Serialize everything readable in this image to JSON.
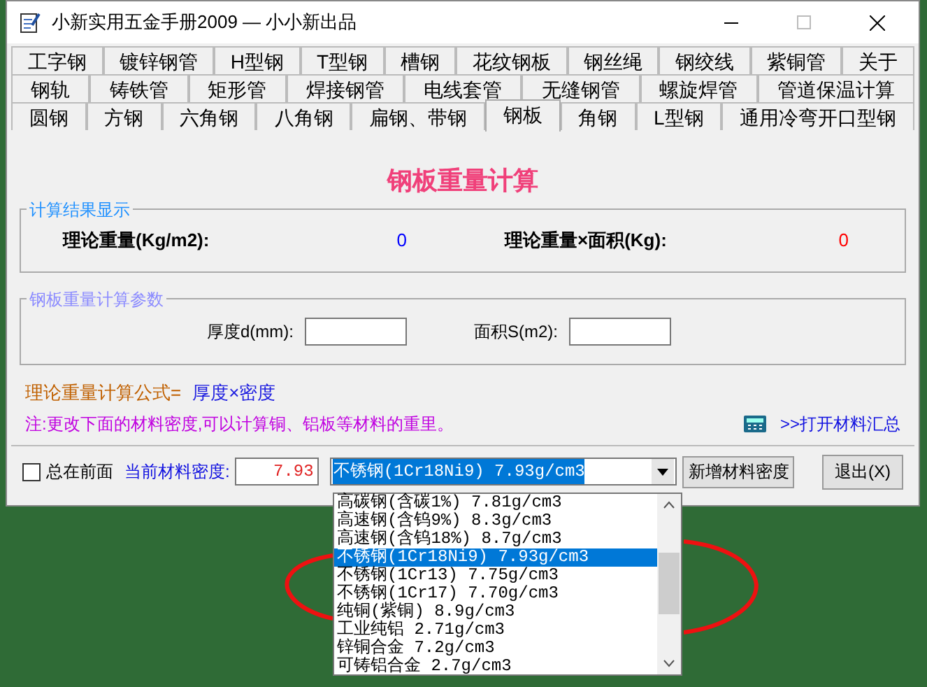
{
  "window": {
    "title": "小新实用五金手册2009 — 小小新出品"
  },
  "tab_rows": [
    [
      {
        "label": "工字钢",
        "selected": false
      },
      {
        "label": "镀锌钢管",
        "selected": false
      },
      {
        "label": "H型钢",
        "selected": false
      },
      {
        "label": "T型钢",
        "selected": false
      },
      {
        "label": "槽钢",
        "selected": false
      },
      {
        "label": "花纹钢板",
        "selected": false
      },
      {
        "label": "钢丝绳",
        "selected": false
      },
      {
        "label": "钢绞线",
        "selected": false
      },
      {
        "label": "紫铜管",
        "selected": false
      },
      {
        "label": "关于",
        "selected": false
      }
    ],
    [
      {
        "label": "钢轨",
        "selected": false
      },
      {
        "label": "铸铁管",
        "selected": false
      },
      {
        "label": "矩形管",
        "selected": false
      },
      {
        "label": "焊接钢管",
        "selected": false
      },
      {
        "label": "电线套管",
        "selected": false
      },
      {
        "label": "无缝钢管",
        "selected": false
      },
      {
        "label": "螺旋焊管",
        "selected": false
      },
      {
        "label": "管道保温计算",
        "selected": false
      }
    ],
    [
      {
        "label": "圆钢",
        "selected": false
      },
      {
        "label": "方钢",
        "selected": false
      },
      {
        "label": "六角钢",
        "selected": false
      },
      {
        "label": "八角钢",
        "selected": false
      },
      {
        "label": "扁钢、带钢",
        "selected": false
      },
      {
        "label": "钢板",
        "selected": true
      },
      {
        "label": "角钢",
        "selected": false
      },
      {
        "label": "L型钢",
        "selected": false
      },
      {
        "label": "通用冷弯开口型钢",
        "selected": false
      }
    ]
  ],
  "heading": "钢板重量计算",
  "results": {
    "title": "计算结果显示",
    "items": [
      {
        "label": "理论重量(Kg/m2):",
        "value": "0",
        "color": "#0000ff"
      },
      {
        "label": "理论重量×面积(Kg):",
        "value": "0",
        "color": "#ff0000"
      }
    ]
  },
  "params": {
    "title": "钢板重量计算参数",
    "fields": [
      {
        "label": "厚度d(mm):"
      },
      {
        "label": "面积S(m2):"
      }
    ]
  },
  "formula": {
    "label": "理论重量计算公式=",
    "value": "厚度×密度"
  },
  "note": "注:更改下面的材料密度,可以计算铜、铝板等材料的重里。",
  "open_summary_link": ">>打开材料汇总",
  "bottom": {
    "always_on_top": {
      "label": "总在前面",
      "checked": false
    },
    "density_label": "当前材料密度:",
    "density_value": "7.93",
    "material": "不锈钢(1Cr18Ni9) 7.93g/cm3",
    "add_button": "新增材料密度",
    "exit_button": "退出(X)"
  },
  "dropdown": {
    "options": [
      {
        "label": "高碳钢(含碳1%) 7.81g/cm3",
        "selected": false
      },
      {
        "label": "高速钢(含钨9%) 8.3g/cm3",
        "selected": false
      },
      {
        "label": "高速钢(含钨18%) 8.7g/cm3",
        "selected": false
      },
      {
        "label": "不锈钢(1Cr18Ni9) 7.93g/cm3",
        "selected": true
      },
      {
        "label": "不锈钢(1Cr13) 7.75g/cm3",
        "selected": false
      },
      {
        "label": "不锈钢(1Cr17) 7.70g/cm3",
        "selected": false
      },
      {
        "label": "纯铜(紫铜) 8.9g/cm3",
        "selected": false
      },
      {
        "label": "工业纯铝 2.71g/cm3",
        "selected": false
      },
      {
        "label": "锌铜合金 7.2g/cm3",
        "selected": false
      },
      {
        "label": "可铸铝合金 2.7g/cm3",
        "selected": false
      }
    ]
  }
}
